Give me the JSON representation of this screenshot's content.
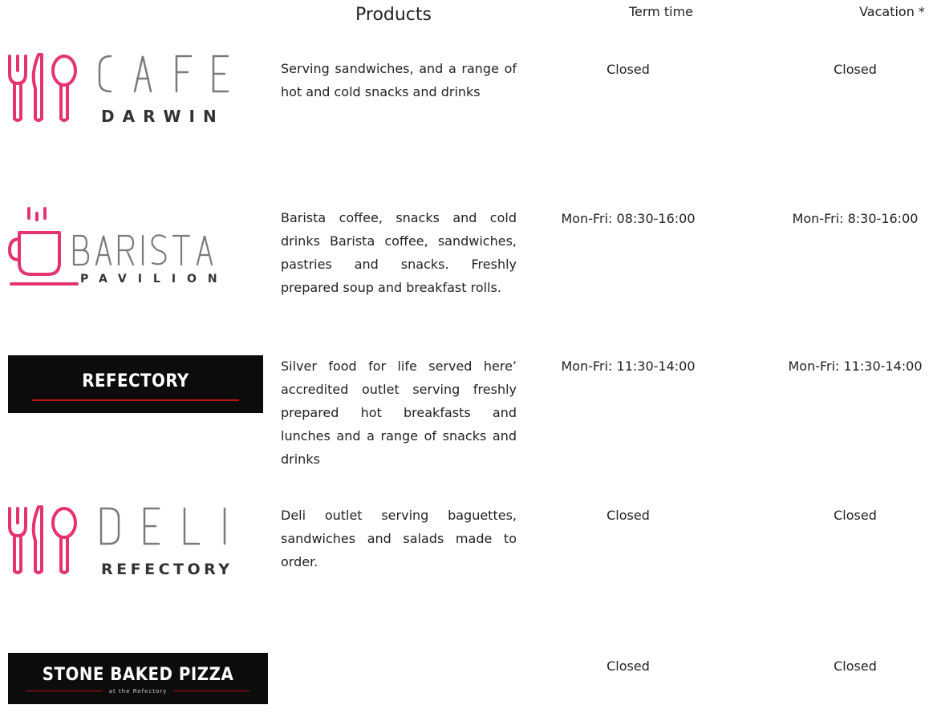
{
  "header": {
    "products": "Products",
    "term_time": "Term time",
    "vacation": "Vacation *"
  },
  "brand_colors": {
    "pink": "#e5336f",
    "grey": "#7a7a7a",
    "dark": "#0c0c0c",
    "red": "#c01414"
  },
  "outlets": [
    {
      "logo": {
        "word": "CAFE",
        "sub": "DARWIN",
        "icon": "fork-knife-spoon-icon"
      },
      "products": "Serving sandwiches, and a range of hot and cold snacks and drinks",
      "term": "Closed",
      "vacation": "Closed"
    },
    {
      "logo": {
        "word": "BARISTA",
        "sub": "PAVILION",
        "icon": "coffee-cup-icon"
      },
      "products": "Barista coffee, snacks and cold drinks Barista coffee, sandwiches, pastries and snacks. Freshly prepared soup and breakfast rolls.",
      "term": "Mon-Fri: 08:30-16:00",
      "vacation": "Mon-Fri: 8:30-16:00"
    },
    {
      "logo": {
        "word": "REFECTORY"
      },
      "products": "Silver food for life served here’ accredited outlet serving freshly prepared hot breakfasts and lunches and a range of snacks and drinks",
      "term": "Mon-Fri: 11:30-14:00",
      "vacation": "Mon-Fri: 11:30-14:00"
    },
    {
      "logo": {
        "word": "DELI",
        "sub": "REFECTORY",
        "icon": "fork-knife-spoon-icon"
      },
      "products": "Deli outlet serving baguettes, sandwiches and salads made to order.",
      "term": "Closed",
      "vacation": "Closed"
    },
    {
      "logo": {
        "word": "STONE BAKED PIZZA",
        "sub": "at the Refectory"
      },
      "products": "",
      "term": "Closed",
      "vacation": "Closed"
    }
  ]
}
